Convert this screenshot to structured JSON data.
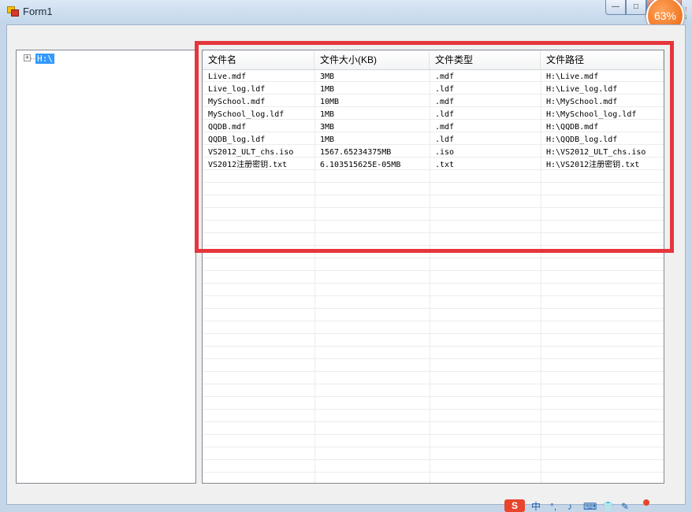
{
  "window": {
    "title": "Form1",
    "buttons": {
      "minimize": "—",
      "maximize": "□",
      "close": ""
    }
  },
  "overlay": {
    "percent": "63%",
    "up_arrow": "↑",
    "down_arrow": "↓"
  },
  "tree": {
    "nodes": [
      {
        "expander": "+",
        "label": "H:\\",
        "selected": true
      }
    ]
  },
  "list": {
    "columns": [
      "文件名",
      "文件大小(KB)",
      "文件类型",
      "文件路径"
    ],
    "rows": [
      [
        "Live.mdf",
        "3MB",
        ".mdf",
        "H:\\Live.mdf"
      ],
      [
        "Live_log.ldf",
        "1MB",
        ".ldf",
        "H:\\Live_log.ldf"
      ],
      [
        "MySchool.mdf",
        "10MB",
        ".mdf",
        "H:\\MySchool.mdf"
      ],
      [
        "MySchool_log.ldf",
        "1MB",
        ".ldf",
        "H:\\MySchool_log.ldf"
      ],
      [
        "QQDB.mdf",
        "3MB",
        ".mdf",
        "H:\\QQDB.mdf"
      ],
      [
        "QQDB_log.ldf",
        "1MB",
        ".ldf",
        "H:\\QQDB_log.ldf"
      ],
      [
        "VS2012_ULT_chs.iso",
        "1567.65234375MB",
        ".iso",
        "H:\\VS2012_ULT_chs.iso"
      ],
      [
        "VS2012注册密钥.txt",
        "6.103515625E-05MB",
        ".txt",
        "H:\\VS2012注册密钥.txt"
      ]
    ]
  },
  "taskbar_ime": {
    "logo": "S",
    "glyphs": [
      "中",
      "°,",
      "♪",
      "⌨",
      "👕",
      "✎"
    ]
  },
  "colors": {
    "selection": "#3399ff",
    "highlight_box": "#e5363c",
    "badge": "#f07a1c"
  }
}
